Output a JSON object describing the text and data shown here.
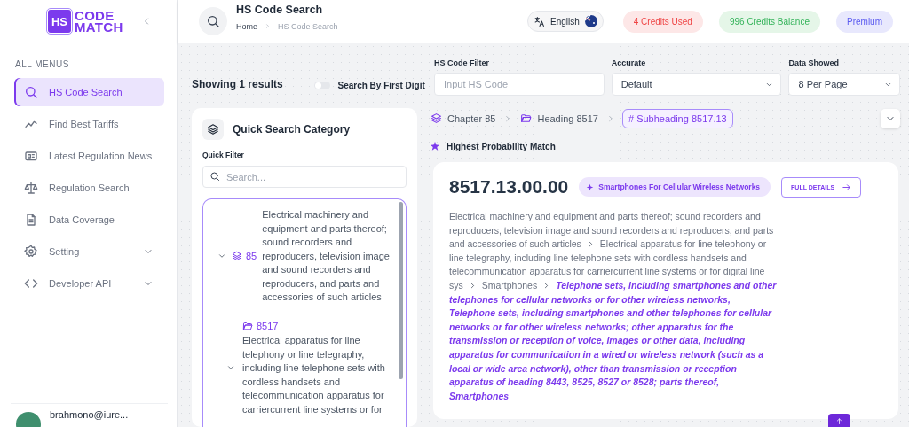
{
  "sidebar": {
    "logo": {
      "mark": "HS",
      "line1": "CODE",
      "line2": "MATCH"
    },
    "section_label": "ALL MENUS",
    "items": [
      {
        "label": "HS Code Search",
        "kind": "link",
        "selected": true
      },
      {
        "label": "Find Best Tariffs",
        "kind": "link",
        "selected": false
      },
      {
        "label": "Latest Regulation News",
        "kind": "link",
        "selected": false
      },
      {
        "label": "Regulation Search",
        "kind": "link",
        "selected": false
      },
      {
        "label": "Data Coverage",
        "kind": "link",
        "selected": false
      },
      {
        "label": "Setting",
        "kind": "group",
        "selected": false
      },
      {
        "label": "Developer API",
        "kind": "group",
        "selected": false
      }
    ],
    "user": {
      "email": "brahmono@iure..."
    }
  },
  "header": {
    "title": "HS Code Search",
    "breadcrumbs": [
      "Home",
      "HS Code Search"
    ],
    "language": "English",
    "badges": [
      {
        "label": "4 Credits Used",
        "kind": "used"
      },
      {
        "label": "996 Credits Balance",
        "kind": "balance"
      },
      {
        "label": "Premium",
        "kind": "plan"
      }
    ]
  },
  "results_bar": {
    "summary": "Showing 1 results",
    "first_digit_toggle": {
      "label": "Search By First Digit",
      "on": false
    },
    "filters": [
      {
        "label": "HS Code Filter",
        "kind": "input",
        "placeholder": "Input HS Code"
      },
      {
        "label": "Accurate",
        "kind": "select",
        "value": "Default"
      },
      {
        "label": "Data Showed",
        "kind": "select",
        "value": "8 Per Page"
      }
    ]
  },
  "quick_search": {
    "title": "Quick Search Category",
    "filter_label": "Quick Filter",
    "placeholder": "Search...",
    "tree": [
      {
        "kind": "chapter",
        "code": "85",
        "text": "Electrical machinery and equipment and parts thereof; sound recorders and reproducers, television image and sound recorders and reproducers, and parts and accessories of such articles",
        "expanded": true,
        "children": [
          {
            "kind": "heading",
            "code": "8517",
            "text": "Electrical apparatus for line telephony or line telegraphy, including line telephone sets with cordless handsets and telecommunication apparatus for carriercurrent line systems or for",
            "expanded": true
          }
        ]
      }
    ]
  },
  "classification_path": [
    {
      "kind": "chapter",
      "label": "Chapter 85",
      "selected": false
    },
    {
      "kind": "heading",
      "label": "Heading 8517",
      "selected": false
    },
    {
      "kind": "subheading",
      "label": "# Subheading 8517.13",
      "selected": true
    }
  ],
  "match_label": "Highest Probability Match",
  "result": {
    "code": "8517.13.00.00",
    "tag": "Smartphones For Cellular Wireless Networks",
    "details_button": "FULL DETAILS",
    "path": [
      "Electrical machinery and equipment and parts thereof; sound recorders and reproducers, television image and sound recorders and reproducers, and parts and accessories of such articles",
      "Electrical apparatus for line telephony or line telegraphy, including line telephone sets with cordless handsets and telecommunication apparatus for carriercurrent line systems or for digital line sys",
      "Smartphones"
    ],
    "description": "Telephone sets, including smartphones and other telephones for cellular networks or for other wireless networks, Telephone sets, including smartphones and other telephones for cellular networks or for other wireless networks; other apparatus for the transmission or reception of voice, images or other data, including apparatus for communication in a wired or wireless network (such as a local or wide area network), other than transmission or reception apparatus of heading 8443, 8525, 8527 or 8528; parts thereof, Smartphones"
  }
}
